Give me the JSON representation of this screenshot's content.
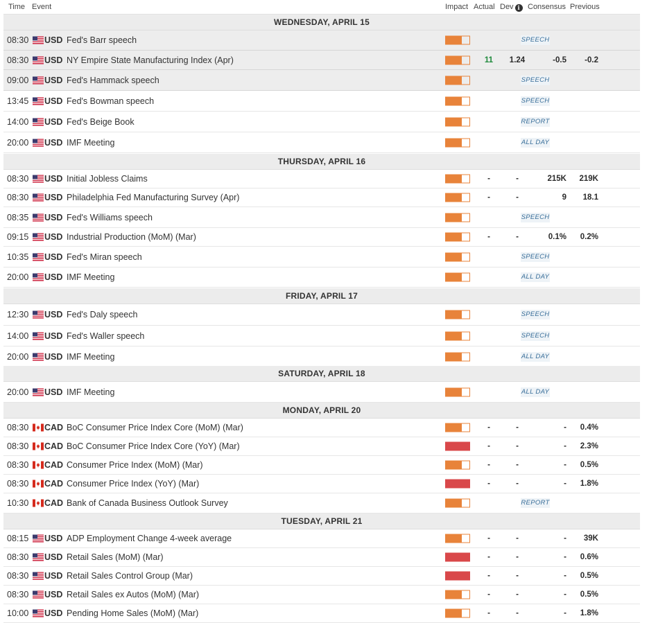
{
  "header": {
    "time": "Time",
    "event": "Event",
    "impact": "Impact",
    "actual": "Actual",
    "dev": "Dev",
    "consensus": "Consensus",
    "previous": "Previous"
  },
  "colors": {
    "impact_medium": "#e8833a",
    "impact_high": "#d9484a",
    "deviation_positive": "#1f8a3c",
    "tag_text": "#3a6f9a"
  },
  "days": [
    {
      "label": "WEDNESDAY, APRIL 15",
      "events": [
        {
          "time": "08:30",
          "flag": "us-flag-icon",
          "currency": "USD",
          "event": "Fed's Barr speech",
          "impact": "medium",
          "tag": "SPEECH",
          "highlight": true
        },
        {
          "time": "08:30",
          "flag": "us-flag-icon",
          "currency": "USD",
          "event": "NY Empire State Manufacturing Index (Apr)",
          "impact": "medium",
          "actual": "11",
          "dev": "1.24",
          "consensus": "-0.5",
          "previous": "-0.2",
          "actual_color": "green",
          "highlight": true
        },
        {
          "time": "09:00",
          "flag": "us-flag-icon",
          "currency": "USD",
          "event": "Fed's Hammack speech",
          "impact": "medium",
          "tag": "SPEECH",
          "highlight": true
        },
        {
          "time": "13:45",
          "flag": "us-flag-icon",
          "currency": "USD",
          "event": "Fed's Bowman speech",
          "impact": "medium",
          "tag": "SPEECH"
        },
        {
          "time": "14:00",
          "flag": "us-flag-icon",
          "currency": "USD",
          "event": "Fed's Beige Book",
          "impact": "medium",
          "tag": "REPORT"
        },
        {
          "time": "20:00",
          "flag": "us-flag-icon",
          "currency": "USD",
          "event": "IMF Meeting",
          "impact": "medium",
          "tag": "ALL DAY"
        }
      ]
    },
    {
      "label": "THURSDAY, APRIL 16",
      "events": [
        {
          "time": "08:30",
          "flag": "us-flag-icon",
          "currency": "USD",
          "event": "Initial Jobless Claims",
          "impact": "medium",
          "actual": "-",
          "dev": "-",
          "consensus": "215K",
          "previous": "219K"
        },
        {
          "time": "08:30",
          "flag": "us-flag-icon",
          "currency": "USD",
          "event": "Philadelphia Fed Manufacturing Survey (Apr)",
          "impact": "medium",
          "actual": "-",
          "dev": "-",
          "consensus": "9",
          "previous": "18.1"
        },
        {
          "time": "08:35",
          "flag": "us-flag-icon",
          "currency": "USD",
          "event": "Fed's Williams speech",
          "impact": "medium",
          "tag": "SPEECH"
        },
        {
          "time": "09:15",
          "flag": "us-flag-icon",
          "currency": "USD",
          "event": "Industrial Production (MoM) (Mar)",
          "impact": "medium",
          "actual": "-",
          "dev": "-",
          "consensus": "0.1%",
          "previous": "0.2%"
        },
        {
          "time": "10:35",
          "flag": "us-flag-icon",
          "currency": "USD",
          "event": "Fed's Miran speech",
          "impact": "medium",
          "tag": "SPEECH"
        },
        {
          "time": "20:00",
          "flag": "us-flag-icon",
          "currency": "USD",
          "event": "IMF Meeting",
          "impact": "medium",
          "tag": "ALL DAY"
        }
      ]
    },
    {
      "label": "FRIDAY, APRIL 17",
      "events": [
        {
          "time": "12:30",
          "flag": "us-flag-icon",
          "currency": "USD",
          "event": "Fed's Daly speech",
          "impact": "medium",
          "tag": "SPEECH"
        },
        {
          "time": "14:00",
          "flag": "us-flag-icon",
          "currency": "USD",
          "event": "Fed's Waller speech",
          "impact": "medium",
          "tag": "SPEECH"
        },
        {
          "time": "20:00",
          "flag": "us-flag-icon",
          "currency": "USD",
          "event": "IMF Meeting",
          "impact": "medium",
          "tag": "ALL DAY"
        }
      ]
    },
    {
      "label": "SATURDAY, APRIL 18",
      "events": [
        {
          "time": "20:00",
          "flag": "us-flag-icon",
          "currency": "USD",
          "event": "IMF Meeting",
          "impact": "medium",
          "tag": "ALL DAY"
        }
      ]
    },
    {
      "label": "MONDAY, APRIL 20",
      "events": [
        {
          "time": "08:30",
          "flag": "ca-flag-icon",
          "currency": "CAD",
          "event": "BoC Consumer Price Index Core (MoM) (Mar)",
          "impact": "medium",
          "actual": "-",
          "dev": "-",
          "consensus": "-",
          "previous": "0.4%"
        },
        {
          "time": "08:30",
          "flag": "ca-flag-icon",
          "currency": "CAD",
          "event": "BoC Consumer Price Index Core (YoY) (Mar)",
          "impact": "high",
          "actual": "-",
          "dev": "-",
          "consensus": "-",
          "previous": "2.3%"
        },
        {
          "time": "08:30",
          "flag": "ca-flag-icon",
          "currency": "CAD",
          "event": "Consumer Price Index (MoM) (Mar)",
          "impact": "medium",
          "actual": "-",
          "dev": "-",
          "consensus": "-",
          "previous": "0.5%"
        },
        {
          "time": "08:30",
          "flag": "ca-flag-icon",
          "currency": "CAD",
          "event": "Consumer Price Index (YoY) (Mar)",
          "impact": "high",
          "actual": "-",
          "dev": "-",
          "consensus": "-",
          "previous": "1.8%"
        },
        {
          "time": "10:30",
          "flag": "ca-flag-icon",
          "currency": "CAD",
          "event": "Bank of Canada Business Outlook Survey",
          "impact": "medium",
          "tag": "REPORT"
        }
      ]
    },
    {
      "label": "TUESDAY, APRIL 21",
      "events": [
        {
          "time": "08:15",
          "flag": "us-flag-icon",
          "currency": "USD",
          "event": "ADP Employment Change 4-week average",
          "impact": "medium",
          "actual": "-",
          "dev": "-",
          "consensus": "-",
          "previous": "39K"
        },
        {
          "time": "08:30",
          "flag": "us-flag-icon",
          "currency": "USD",
          "event": "Retail Sales (MoM) (Mar)",
          "impact": "high",
          "actual": "-",
          "dev": "-",
          "consensus": "-",
          "previous": "0.6%"
        },
        {
          "time": "08:30",
          "flag": "us-flag-icon",
          "currency": "USD",
          "event": "Retail Sales Control Group (Mar)",
          "impact": "high",
          "actual": "-",
          "dev": "-",
          "consensus": "-",
          "previous": "0.5%"
        },
        {
          "time": "08:30",
          "flag": "us-flag-icon",
          "currency": "USD",
          "event": "Retail Sales ex Autos (MoM) (Mar)",
          "impact": "medium",
          "actual": "-",
          "dev": "-",
          "consensus": "-",
          "previous": "0.5%"
        },
        {
          "time": "10:00",
          "flag": "us-flag-icon",
          "currency": "USD",
          "event": "Pending Home Sales (MoM) (Mar)",
          "impact": "medium",
          "actual": "-",
          "dev": "-",
          "consensus": "-",
          "previous": "1.8%"
        }
      ]
    }
  ]
}
